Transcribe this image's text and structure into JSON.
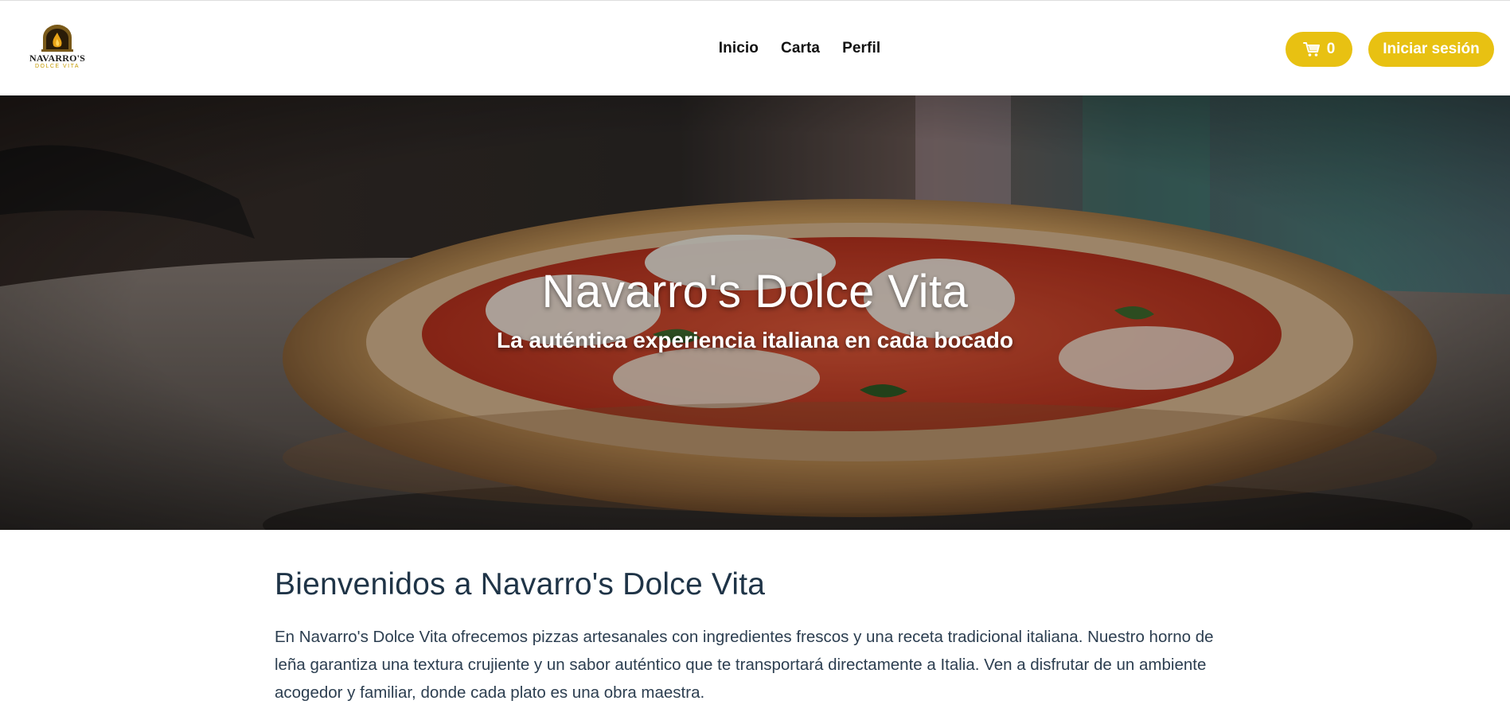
{
  "header": {
    "logo": {
      "name": "NAVARRO'S",
      "sub": "DOLCE VITA"
    },
    "nav": [
      {
        "label": "Inicio"
      },
      {
        "label": "Carta"
      },
      {
        "label": "Perfil"
      }
    ],
    "cart": {
      "icon": "cart-icon",
      "count": "0"
    },
    "login_label": "Iniciar sesión",
    "accent_color": "#e8c112"
  },
  "hero": {
    "title": "Navarro's Dolce Vita",
    "subtitle": "La auténtica experiencia italiana en cada bocado",
    "background": "wood-fired margherita pizza photo"
  },
  "welcome": {
    "heading": "Bienvenidos a Navarro's Dolce Vita",
    "text": "En Navarro's Dolce Vita ofrecemos pizzas artesanales con ingredientes frescos y una receta tradicional italiana. Nuestro horno de leña garantiza una textura crujiente y un sabor auténtico que te transportará directamente a Italia. Ven a disfrutar de un ambiente acogedor y familiar, donde cada plato es una obra maestra."
  }
}
